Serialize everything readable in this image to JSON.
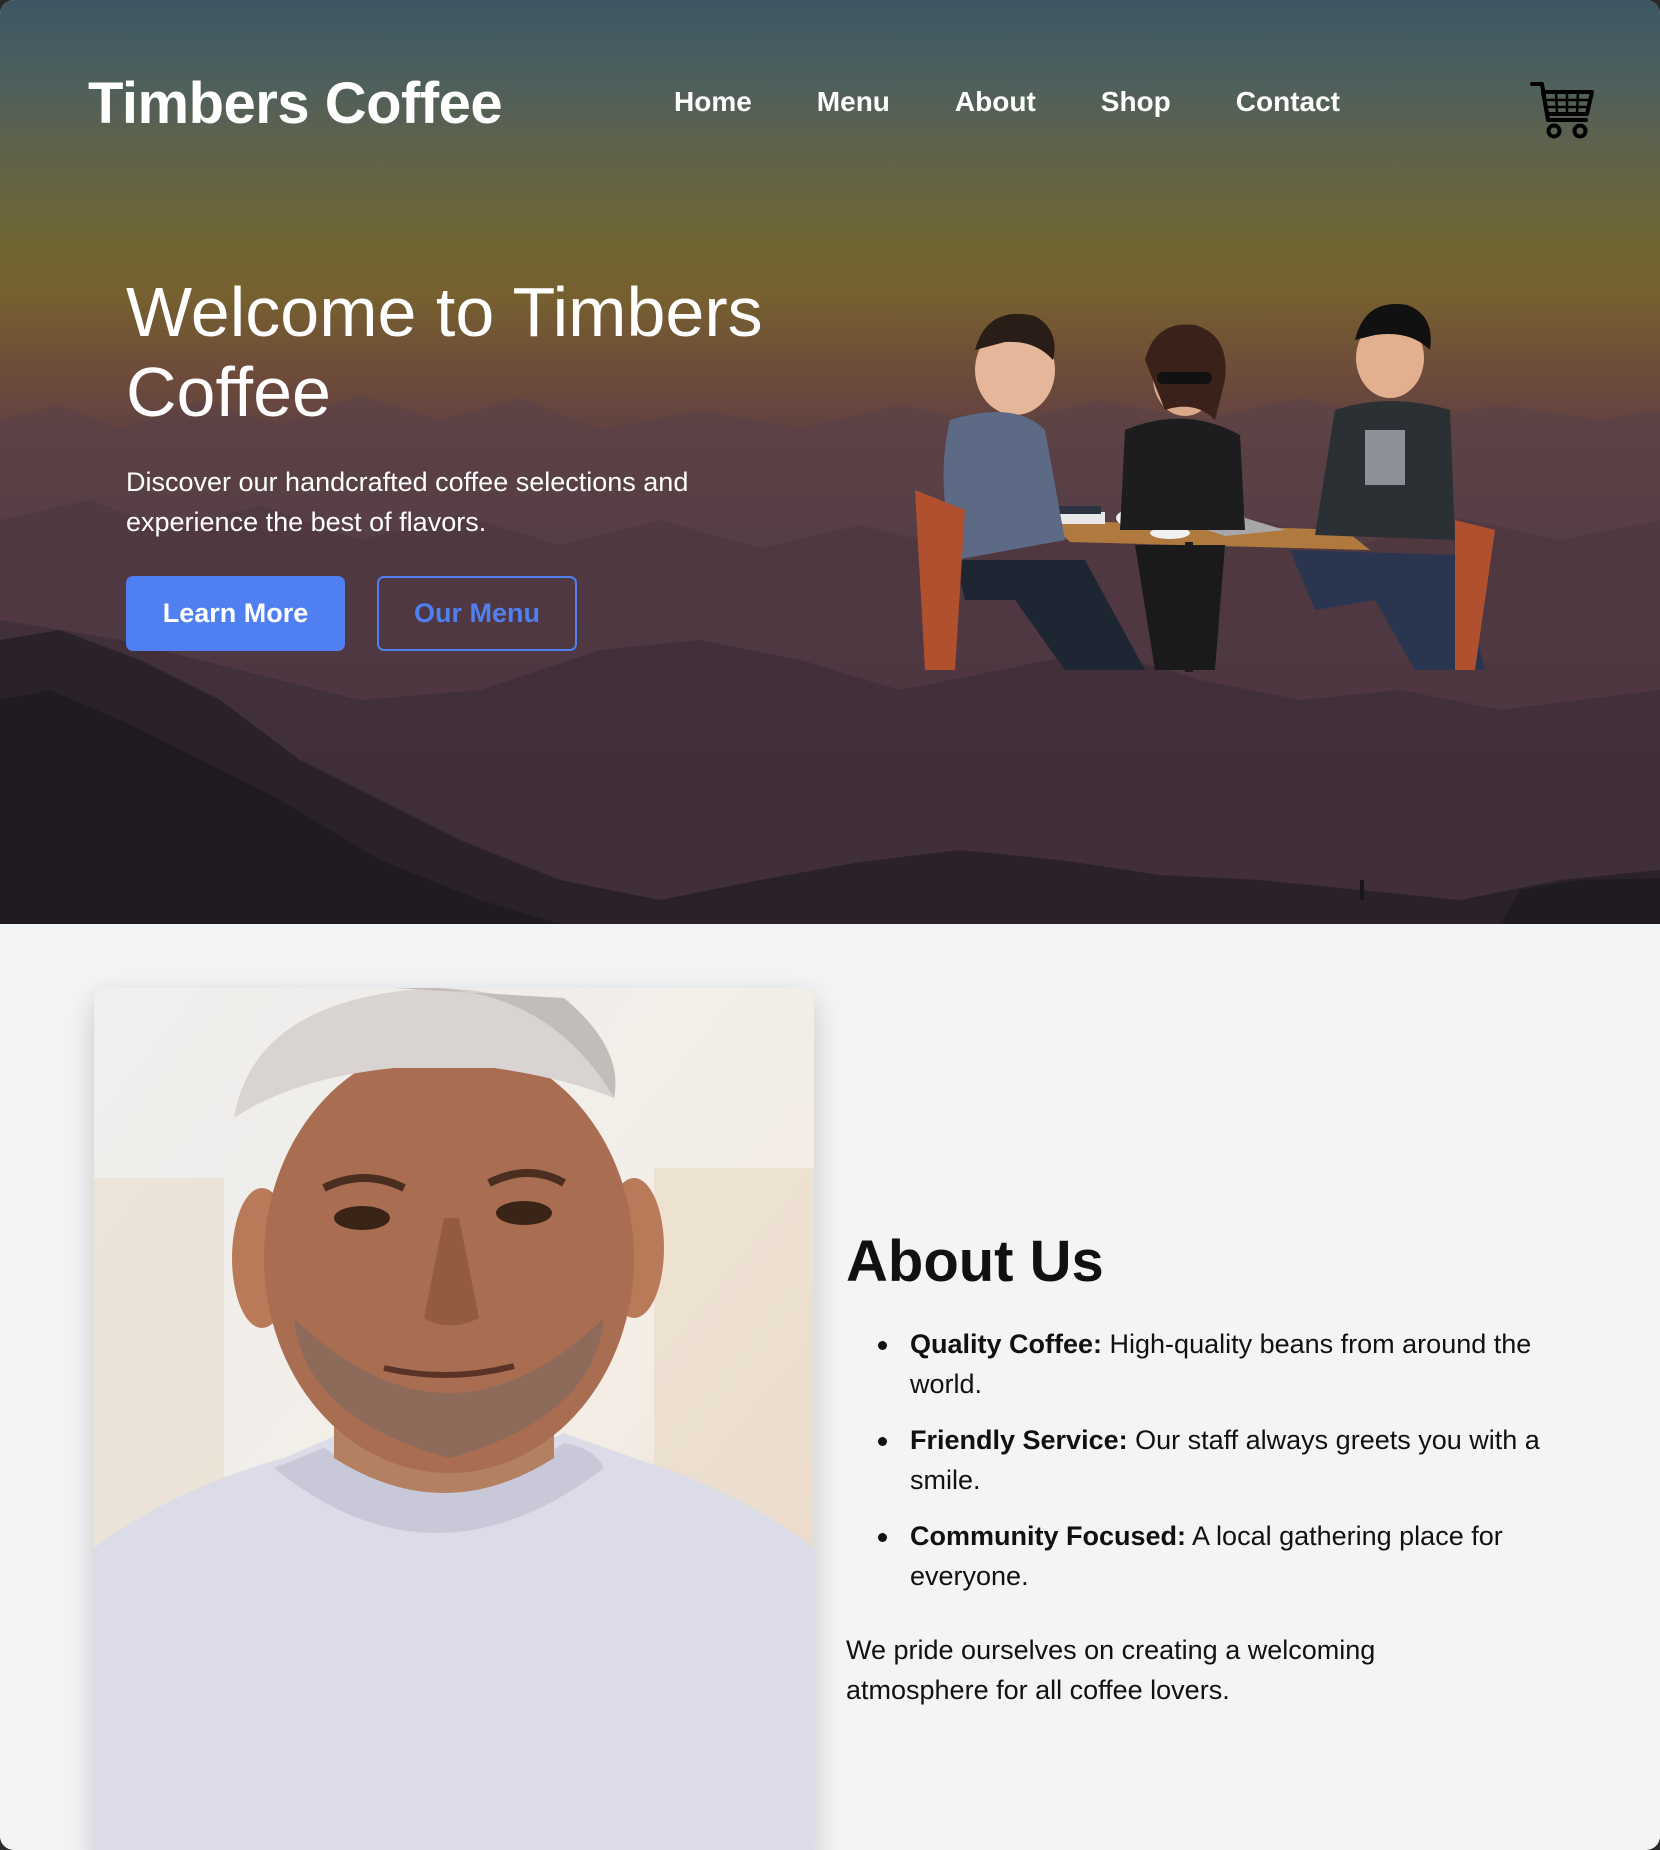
{
  "brand": {
    "name": "Timbers Coffee"
  },
  "nav": {
    "items": [
      {
        "label": "Home"
      },
      {
        "label": "Menu"
      },
      {
        "label": "About"
      },
      {
        "label": "Shop"
      },
      {
        "label": "Contact"
      }
    ],
    "cart_icon": "shopping-cart-icon"
  },
  "hero": {
    "title": "Welcome to Timbers Coffee",
    "subtitle": "Discover our handcrafted coffee selections and experience the best of flavors.",
    "primary_button": "Learn More",
    "secondary_button": "Our Menu"
  },
  "about": {
    "title": "About Us",
    "items": [
      {
        "title": "Quality Coffee:",
        "text": " High-quality beans from around the world."
      },
      {
        "title": "Friendly Service:",
        "text": " Our staff always greets you with a smile."
      },
      {
        "title": "Community Focused:",
        "text": " A local gathering place for everyone."
      }
    ],
    "footer": "We pride ourselves on creating a welcoming atmosphere for all coffee lovers."
  },
  "colors": {
    "accent": "#4f7ff0",
    "section_bg": "#f3f4f6",
    "text": "#111111"
  }
}
